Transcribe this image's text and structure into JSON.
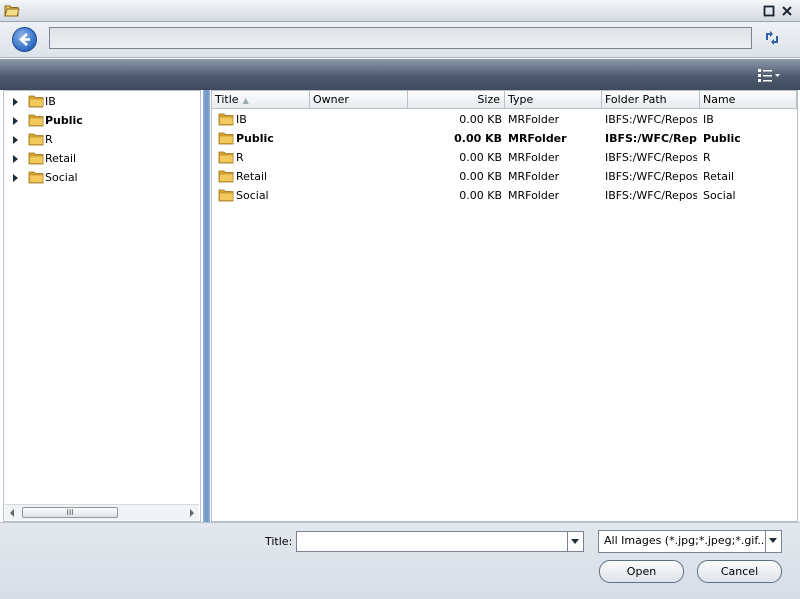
{
  "window": {
    "icons": {
      "app": "folder-open-icon",
      "maximize": "maximize-icon",
      "close": "close-icon"
    }
  },
  "toolbar": {
    "address_value": "",
    "icons": {
      "back": "back-arrow-icon",
      "refresh": "refresh-icon",
      "view": "view-options-icon"
    }
  },
  "tree": {
    "items": [
      {
        "label": "IB",
        "bold": false
      },
      {
        "label": "Public",
        "bold": true
      },
      {
        "label": "R",
        "bold": false
      },
      {
        "label": "Retail",
        "bold": false
      },
      {
        "label": "Social",
        "bold": false
      }
    ],
    "scroll_thumb": "III"
  },
  "list": {
    "columns": [
      "Title",
      "Owner",
      "Size",
      "Type",
      "Folder Path",
      "Name"
    ],
    "rows": [
      {
        "title": "IB",
        "owner": "",
        "size": "0.00 KB",
        "type": "MRFolder",
        "path": "IBFS:/WFC/Repository/IB",
        "name": "IB",
        "bold": false
      },
      {
        "title": "Public",
        "owner": "",
        "size": "0.00 KB",
        "type": "MRFolder",
        "path": "IBFS:/WFC/Repository/Public",
        "name": "Public",
        "bold": true
      },
      {
        "title": "R",
        "owner": "",
        "size": "0.00 KB",
        "type": "MRFolder",
        "path": "IBFS:/WFC/Repository/R",
        "name": "R",
        "bold": false
      },
      {
        "title": "Retail",
        "owner": "",
        "size": "0.00 KB",
        "type": "MRFolder",
        "path": "IBFS:/WFC/Repository/Retail",
        "name": "Retail",
        "bold": false
      },
      {
        "title": "Social",
        "owner": "",
        "size": "0.00 KB",
        "type": "MRFolder",
        "path": "IBFS:/WFC/Repository/Social",
        "name": "Social",
        "bold": false
      }
    ]
  },
  "footer": {
    "title_label": "Title:",
    "title_value": "",
    "filter_value": "All Images (*.jpg;*.jpeg;*.gif...",
    "open_label": "Open",
    "cancel_label": "Cancel"
  },
  "colors": {
    "accent": "#3a74c9",
    "band": "#4f5c6e",
    "splitter": "#6d93c4"
  }
}
